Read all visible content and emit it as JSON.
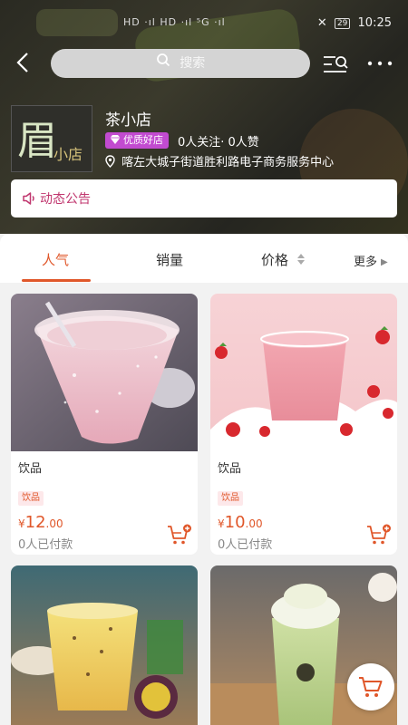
{
  "statusbar": {
    "signal_text": "HD ·ıl HD ·ıl ⁵G ·ıl",
    "time": "10:25",
    "battery": "29"
  },
  "nav": {
    "search_placeholder": "搜索"
  },
  "shop": {
    "name": "茶小店",
    "logo_text_main": "眉",
    "logo_text_sub": "小店",
    "badge": "优质好店",
    "stats": "0人关注· 0人赞",
    "address": "喀左大城子街道胜利路电子商务服务中心"
  },
  "notice": {
    "label": "动态公告"
  },
  "tabs": [
    {
      "label": "人气",
      "active": true
    },
    {
      "label": "销量",
      "active": false
    },
    {
      "label": "价格",
      "active": false
    },
    {
      "label": "更多",
      "active": false
    }
  ],
  "products": [
    {
      "name": "饮品",
      "tag": "饮品",
      "currency": "¥",
      "price_int": "12",
      "price_dec": ".00",
      "sold": "0人已付款"
    },
    {
      "name": "饮品",
      "tag": "饮品",
      "currency": "¥",
      "price_int": "10",
      "price_dec": ".00",
      "sold": "0人已付款"
    }
  ],
  "colors": {
    "accent": "#e0572a",
    "badge": "#c24bd0",
    "notice_text": "#c0366e"
  },
  "icons": [
    "back-icon",
    "search-icon",
    "menu-search-icon",
    "more-icon",
    "diamond-icon",
    "location-pin-icon",
    "speaker-icon",
    "sort-arrows-icon",
    "triangle-right-icon",
    "add-cart-icon",
    "cart-icon"
  ]
}
